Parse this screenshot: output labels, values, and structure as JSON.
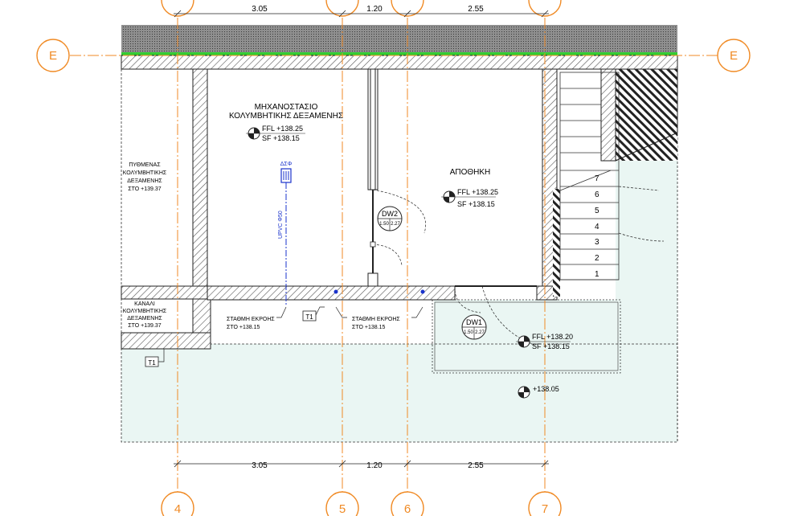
{
  "grid_axes": {
    "top_left": "E",
    "top_right": "E",
    "bottom": [
      "4",
      "5",
      "6",
      "7"
    ]
  },
  "dimensions": {
    "top": [
      "3.05",
      "1.20",
      "2.55"
    ],
    "bottom": [
      "3.05",
      "1.20",
      "2.55"
    ]
  },
  "rooms": {
    "machine_room_line1": "ΜΗΧΑΝΟΣΤΑΣΙΟ",
    "machine_room_line2": "ΚΟΛΥΜΒΗΤΙΚΗΣ ΔΕΞΑΜΕΝΗΣ",
    "storage": "ΑΠΟΘΗΚΗ",
    "pool_bottom_line1": "ΠΥΘΜΕΝΑΣ",
    "pool_bottom_line2": "ΚΟΛΥΜΒΗΤΙΚΗΣ",
    "pool_bottom_line3": "ΔΕΞΑΜΕΝΗΣ",
    "pool_bottom_line4": "ΣΤΟ +139.37",
    "channel_line1": "ΚΑΝΑΛΙ",
    "channel_line2": "ΚΟΛΥΜΒΗΤΙΚΗΣ",
    "channel_line3": "ΔΕΞΑΜΕΝΗΣ",
    "channel_line4": "ΣΤΟ +139.37"
  },
  "levels": {
    "machine_ffl": "FFL +138.25",
    "machine_sf": "SF +138.15",
    "storage_ffl": "FFL +138.25",
    "storage_sf": "SF +138.15",
    "dw1_ffl": "FFL +138.20",
    "dw1_sf": "SF +138.15",
    "ground": "+138.05"
  },
  "annotations": {
    "dsf": "ΔΣΦ",
    "pipe": "UPVC Φ50",
    "outlet1_line1": "ΣΤΑΘΜΗ ΕΚΡΟΗΣ",
    "outlet1_line2": "ΣΤΟ +138.15",
    "outlet2_line1": "ΣΤΑΘΜΗ ΕΚΡΟΗΣ",
    "outlet2_line2": "ΣΤΟ +138.15",
    "t1_a": "T1",
    "t1_b": "T1"
  },
  "doors": {
    "dw2_tag": "DW2",
    "dw2_w": "1.50",
    "dw2_h": "2.27",
    "dw1_tag": "DW1",
    "dw1_w": "1.50",
    "dw1_h": "2.27"
  },
  "stairs": [
    "1",
    "2",
    "3",
    "4",
    "5",
    "6",
    "7"
  ],
  "colors": {
    "axis": "#f08a24",
    "green_edge": "#33cc33",
    "pipe_blue": "#1a33cc",
    "exterior_fill": "#eaf6f3"
  }
}
